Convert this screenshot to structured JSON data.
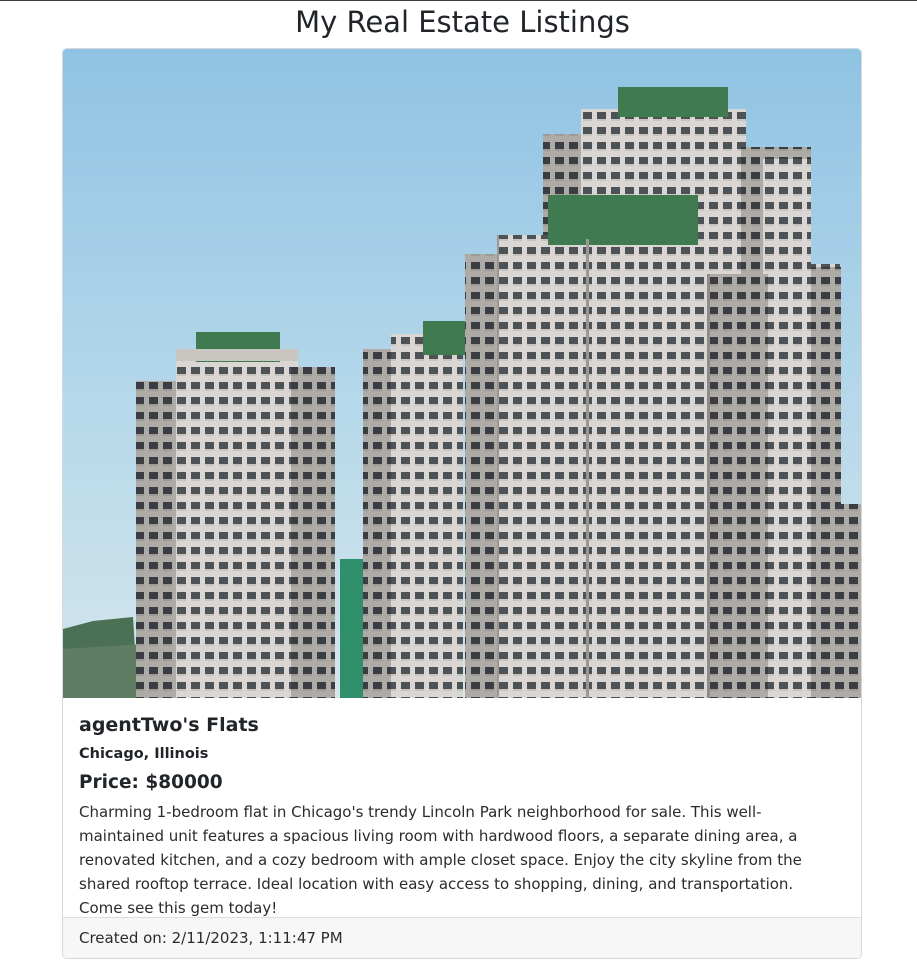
{
  "page": {
    "title": "My Real Estate Listings"
  },
  "listing": {
    "title": "agentTwo's Flats",
    "location": "Chicago, Illinois",
    "price": "Price: $80000",
    "description": "Charming 1-bedroom flat in Chicago's trendy Lincoln Park neighborhood for sale. This well-maintained unit features a spacious living room with hardwood floors, a separate dining area, a renovated kitchen, and a cozy bedroom with ample closet space. Enjoy the city skyline from the shared rooftop terrace. Ideal location with easy access to shopping, dining, and transportation. Come see this gem today!",
    "created": "Created on: 2/11/2023, 1:11:47 PM",
    "image_subject": "high-rise apartment towers with green rooftops against blue sky"
  },
  "colors": {
    "sky_top": "#9dcbe6",
    "sky_bottom": "#cfe3ec",
    "building_light": "#d9d6d3",
    "building_shade": "#a9a6a3",
    "roof_green": "#3f7a50",
    "hill_green": "#4c7053",
    "scaffold_green": "#2f8f6a"
  }
}
